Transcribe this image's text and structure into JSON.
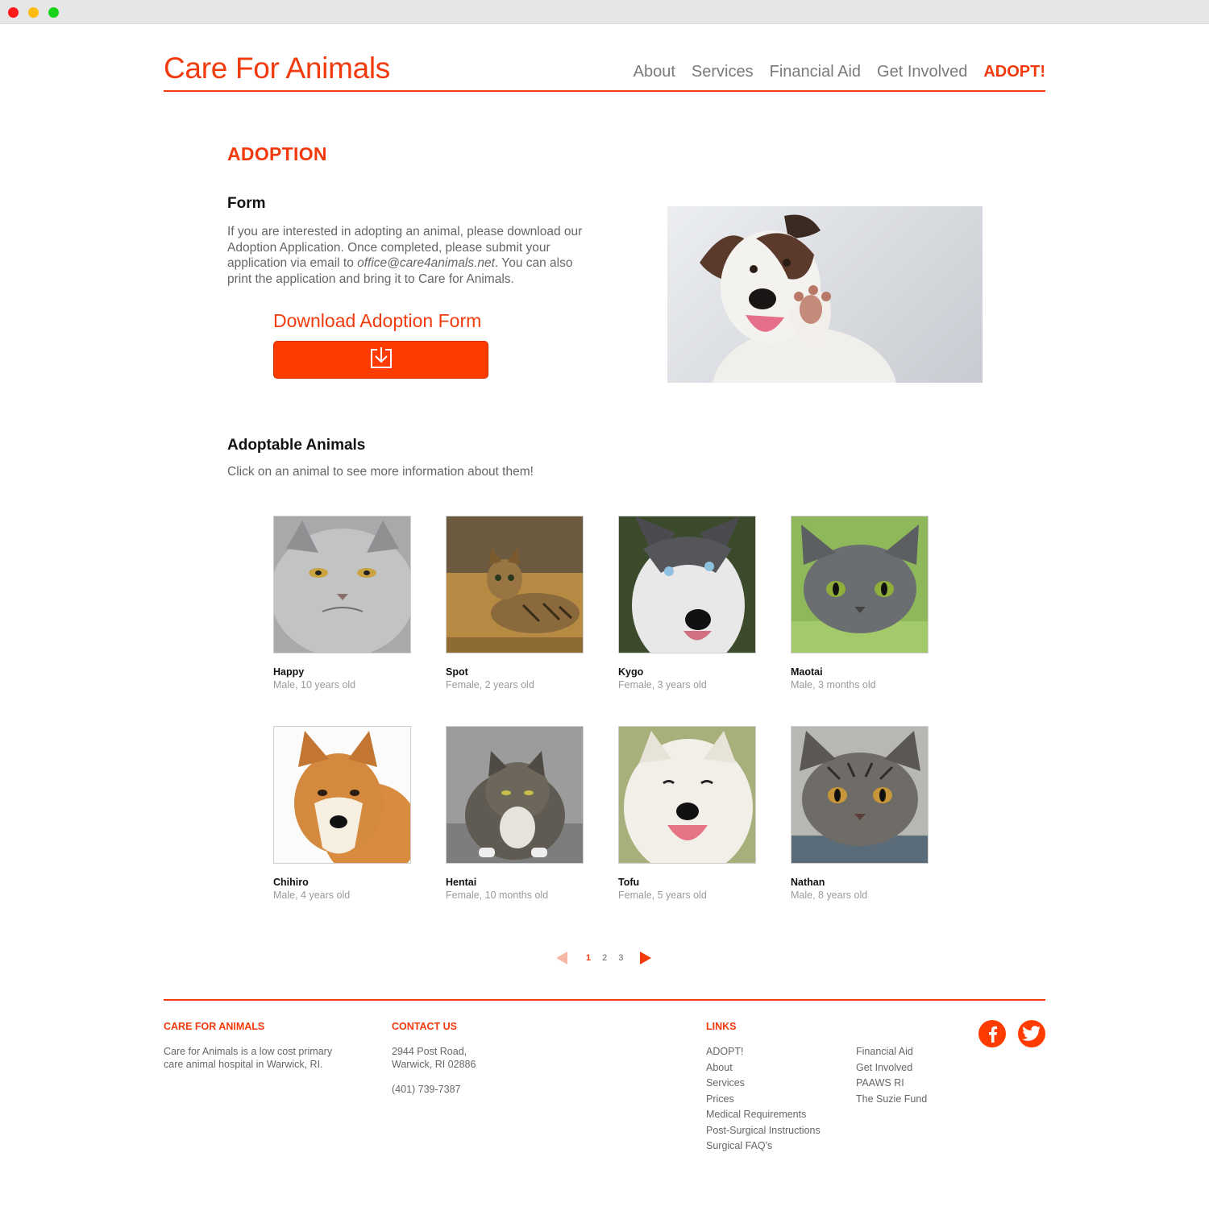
{
  "site": {
    "logo": "Care For Animals",
    "nav": [
      "About",
      "Services",
      "Financial Aid",
      "Get Involved",
      "ADOPT!"
    ],
    "nav_active": "ADOPT!",
    "brand_color": "#f23a0d",
    "button_color": "#ff3b00"
  },
  "adoption": {
    "title": "ADOPTION",
    "form_title": "Form",
    "text_1": "If you are interested in adopting an animal, please download our Adoption Application. Once completed, please submit your application via email to ",
    "email": "office@care4animals.net",
    "text_2": ".  You can also print the application and bring it to Care for Animals.",
    "download_label": "Download Adoption Form",
    "download_icon": "download-icon"
  },
  "animals": {
    "title": "Adoptable Animals",
    "subtitle": "Click on an animal to see more information about them!",
    "items": [
      {
        "name": "Happy",
        "desc": "Male, 10 years old"
      },
      {
        "name": "Spot",
        "desc": "Female, 2 years old"
      },
      {
        "name": "Kygo",
        "desc": "Female, 3 years old"
      },
      {
        "name": "Maotai",
        "desc": "Male, 3 months old"
      },
      {
        "name": "Chihiro",
        "desc": "Male, 4 years old"
      },
      {
        "name": "Hentai",
        "desc": "Female, 10 months old"
      },
      {
        "name": "Tofu",
        "desc": "Female, 5 years old"
      },
      {
        "name": "Nathan",
        "desc": "Male, 8 years old"
      }
    ]
  },
  "pagination": {
    "pages": [
      "1",
      "2",
      "3"
    ],
    "current": "1"
  },
  "footer": {
    "about_heading": "CARE FOR ANIMALS",
    "about_text": "Care for Animals is a low cost primary care animal hospital in Warwick, RI.",
    "contact_heading": "CONTACT US",
    "address_1": "2944 Post Road,",
    "address_2": "Warwick, RI 02886",
    "phone": "(401) 739-7387",
    "links_heading": "LINKS",
    "links_col1": [
      "ADOPT!",
      "About",
      "Services",
      "Prices",
      "Medical Requirements",
      "Post-Surgical Instructions",
      "Surgical FAQ's"
    ],
    "links_col2": [
      "Financial Aid",
      "Get Involved",
      "PAAWS RI",
      "The Suzie Fund"
    ],
    "social": [
      "facebook-icon",
      "twitter-icon"
    ]
  }
}
